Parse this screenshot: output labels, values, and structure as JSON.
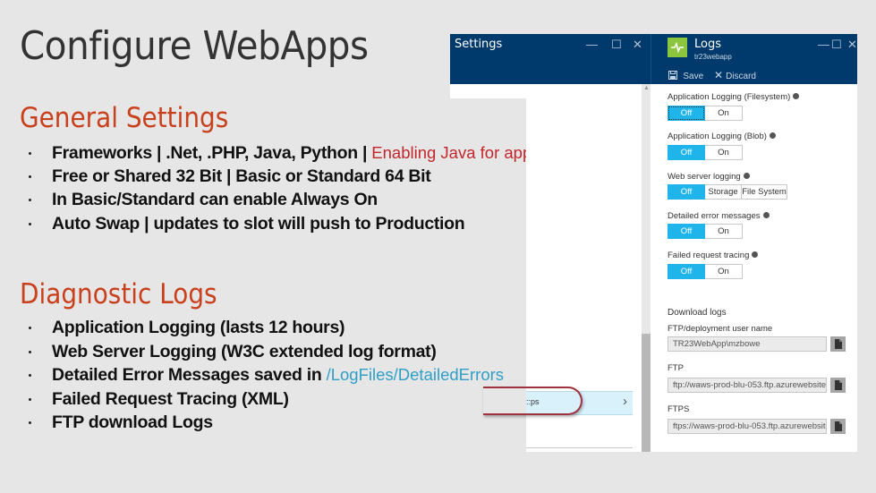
{
  "slide": {
    "title": "Configure WebApps",
    "general_settings": {
      "heading": "General Settings",
      "bullets": [
        {
          "text": "Frameworks | .Net, .PHP, Java, Python | ",
          "note": "Enabling Java for app disables the others!"
        },
        {
          "text": "Free or Shared 32 Bit |  Basic or Standard 64 Bit"
        },
        {
          "text": "In Basic/Standard can enable Always On"
        },
        {
          "text": "Auto Swap | updates to slot will push to Production"
        }
      ]
    },
    "diagnostic_logs": {
      "heading": "Diagnostic Logs",
      "bullets": [
        {
          "text": "Application Logging (lasts 12 hours)"
        },
        {
          "text": "Web Server Logging (W3C extended log format)"
        },
        {
          "text": "Detailed Error Messages saved in ",
          "note": "/LogFiles/DetailedErrors"
        },
        {
          "text": "Failed Request Tracing (XML)"
        },
        {
          "text": "FTP download Logs"
        }
      ]
    }
  },
  "settings_blade": {
    "title": "Settings",
    "controls": {
      "minimize": "—",
      "maximize": "☐",
      "close": "✕"
    },
    "nav_item_partial": "::ps",
    "nav_chevron": "›"
  },
  "logs_blade": {
    "title": "Logs",
    "subtitle": "tr23webapp",
    "icon": "activity-pulse-icon",
    "controls": {
      "minimize": "—",
      "maximize": "☐",
      "close": "✕"
    },
    "commands": {
      "save": "Save",
      "discard": "Discard"
    },
    "settings": [
      {
        "label": "Application Logging (Filesystem)",
        "options": [
          "Off",
          "On"
        ],
        "selected": "Off"
      },
      {
        "label": "Application Logging (Blob)",
        "options": [
          "Off",
          "On"
        ],
        "selected": "Off"
      },
      {
        "label": "Web server logging",
        "options": [
          "Off",
          "Storage",
          "File System"
        ],
        "selected": "Off"
      },
      {
        "label": "Detailed error messages",
        "options": [
          "Off",
          "On"
        ],
        "selected": "Off"
      },
      {
        "label": "Failed request tracing",
        "options": [
          "Off",
          "On"
        ],
        "selected": "Off"
      }
    ],
    "download": {
      "heading": "Download logs",
      "user_label": "FTP/deployment user name",
      "user_value": "TR23WebApp\\mzbowe",
      "ftp_label": "FTP",
      "ftp_value": "ftp://waws-prod-blu-053.ftp.azurewebsites",
      "ftps_label": "FTPS",
      "ftps_value": "ftps://waws-prod-blu-053.ftp.azurewebsites"
    }
  },
  "colors": {
    "accent_orange": "#c9401d",
    "note_red": "#c3262b",
    "note_blue": "#2f9fc7",
    "portal_header": "#003a6c",
    "toggle_on": "#1fb5ea",
    "logs_icon": "#8cc63f"
  }
}
